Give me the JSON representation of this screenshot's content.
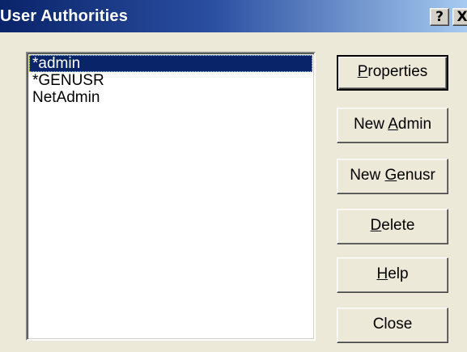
{
  "window": {
    "title": "User Authorities"
  },
  "title_buttons": {
    "help": "?",
    "close": "X"
  },
  "users": {
    "items": [
      "*admin",
      "*GENUSR",
      "NetAdmin"
    ],
    "selected": "*admin"
  },
  "buttons": {
    "properties": {
      "label": "Properties",
      "access_key": "P"
    },
    "new_admin": {
      "label": "New Admin",
      "access_key": "A"
    },
    "new_genusr": {
      "label": "New Genusr",
      "access_key": "G"
    },
    "delete": {
      "label": "Delete",
      "access_key": "D"
    },
    "help": {
      "label": "Help",
      "access_key": "H"
    },
    "close": {
      "label": "Close"
    }
  },
  "colors": {
    "title_gradient_start": "#0A246A",
    "title_gradient_end": "#A6CAF0",
    "dialog_face": "#ECE9D8",
    "selection": "#0A246A",
    "list_background": "#FFFFFF"
  }
}
